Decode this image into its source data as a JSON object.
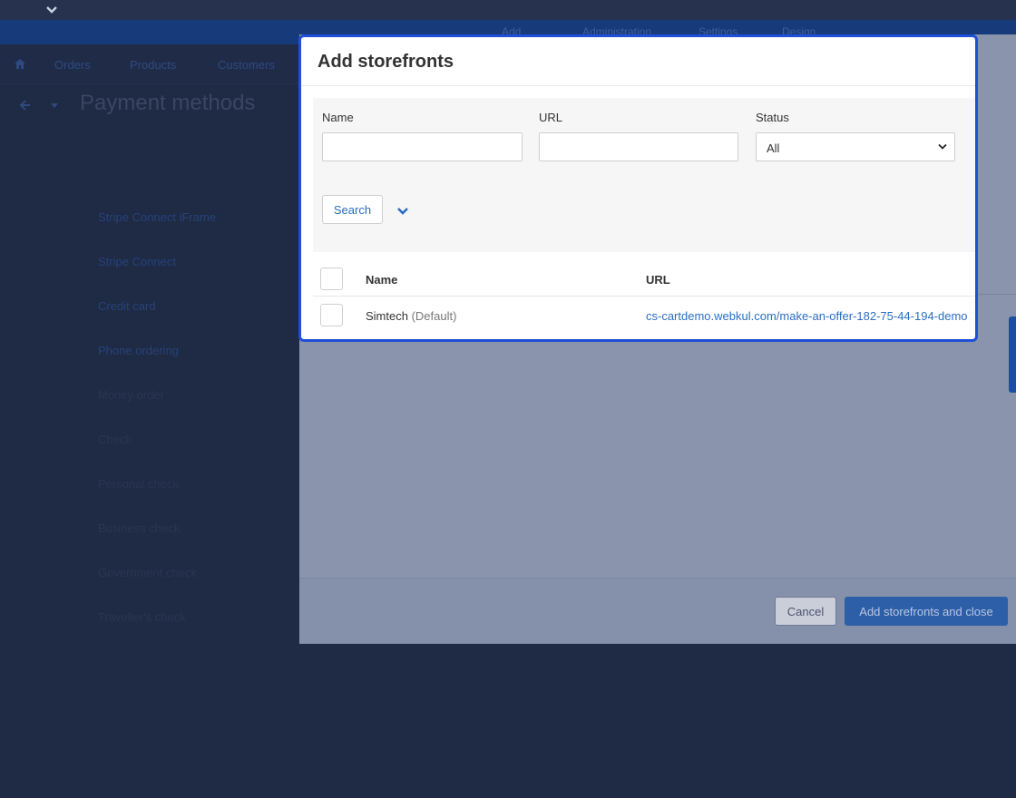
{
  "background": {
    "top_nav_items": [
      "Add",
      "Administration",
      "Settings",
      "Design"
    ],
    "menu_items": [
      "Orders",
      "Products",
      "Customers"
    ],
    "page_title": "Payment methods",
    "payment_methods": [
      {
        "label": "Stripe Connect iFrame",
        "color": "#26427a"
      },
      {
        "label": "Stripe Connect",
        "color": "#26427a"
      },
      {
        "label": "Credit card",
        "color": "#26427a"
      },
      {
        "label": "Phone ordering",
        "color": "#26427a"
      },
      {
        "label": "Money order",
        "color": "#2a3552"
      },
      {
        "label": "Check",
        "color": "#2a3552"
      },
      {
        "label": "Personal check",
        "color": "#2a3552"
      },
      {
        "label": "Business check",
        "color": "#2a3552"
      },
      {
        "label": "Government check",
        "color": "#2a3552"
      },
      {
        "label": "Traveller's check",
        "color": "#2a3552"
      }
    ],
    "cancel_label": "Cancel",
    "add_close_label": "Add storefronts and close"
  },
  "popup": {
    "title": "Add storefronts",
    "filters": {
      "name_label": "Name",
      "name_value": "",
      "url_label": "URL",
      "url_value": "",
      "status_label": "Status",
      "status_value": "All"
    },
    "search_label": "Search",
    "table": {
      "headers": {
        "name": "Name",
        "url": "URL"
      },
      "rows": [
        {
          "name": "Simtech",
          "tag": "(Default)",
          "url": "cs-cartdemo.webkul.com/make-an-offer-182-75-44-194-demo"
        }
      ]
    }
  },
  "colors": {
    "accent": "#2a6ec1",
    "popup_border": "#1f4fd6",
    "primary_button": "#2d5fa9"
  }
}
